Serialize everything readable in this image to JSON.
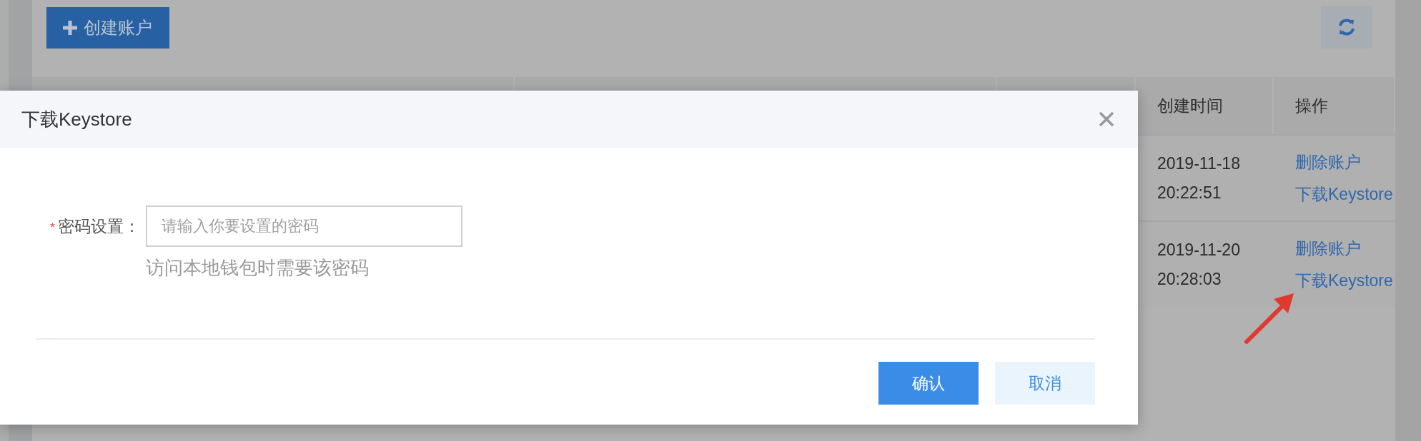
{
  "toolbar": {
    "create_button": {
      "label": "创建账户"
    }
  },
  "table": {
    "columns": [
      {
        "label": "创建时间"
      },
      {
        "label": "操作"
      }
    ],
    "rows": [
      {
        "created_date": "2019-11-18",
        "created_time": "20:22:51",
        "actions": [
          "删除账户",
          "下载Keystore"
        ]
      },
      {
        "created_date": "2019-11-20",
        "created_time": "20:28:03",
        "actions": [
          "删除账户",
          "下载Keystore"
        ]
      }
    ]
  },
  "modal": {
    "title": "下载Keystore",
    "field": {
      "label": "密码设置：",
      "required": true,
      "required_mark": "*",
      "placeholder": "请输入你要设置的密码",
      "hint": "访问本地钱包时需要该密码"
    },
    "buttons": [
      {
        "label": "确认",
        "kind": "primary"
      },
      {
        "label": "取消",
        "kind": "secondary"
      }
    ]
  }
}
